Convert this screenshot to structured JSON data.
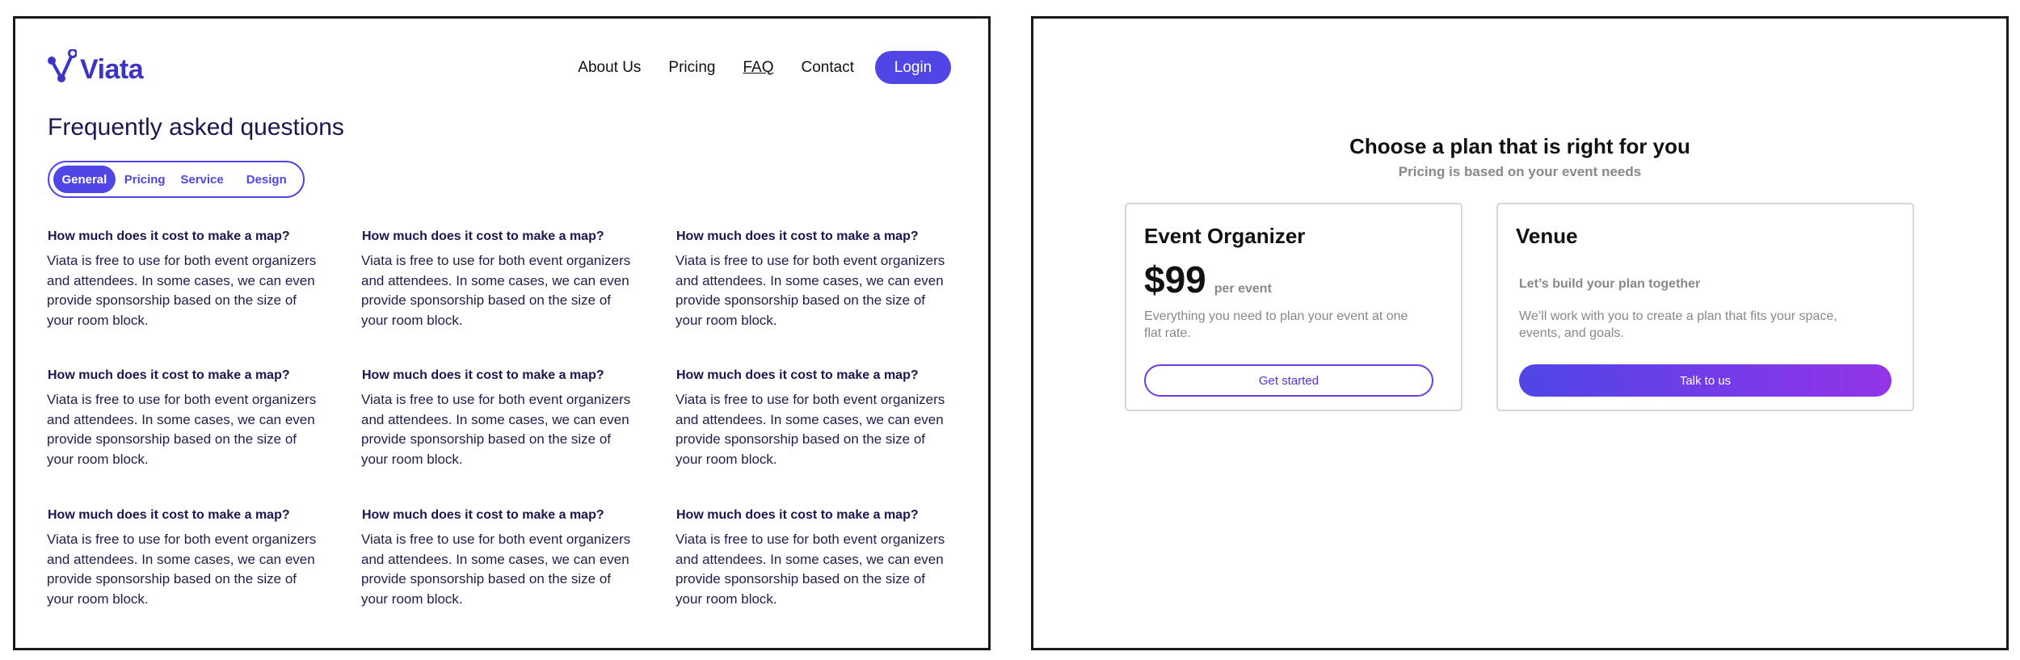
{
  "brand": {
    "name": "Viata",
    "accent": "#4f46e5",
    "logo_icon": "route-pin-icon"
  },
  "nav": {
    "items": [
      {
        "label": "About Us",
        "active": false
      },
      {
        "label": "Pricing",
        "active": false
      },
      {
        "label": "FAQ",
        "active": true
      },
      {
        "label": "Contact",
        "active": false
      }
    ],
    "login_label": "Login"
  },
  "faq": {
    "title": "Frequently asked questions",
    "tabs": [
      {
        "label": "General",
        "active": true
      },
      {
        "label": "Pricing",
        "active": false
      },
      {
        "label": "Service",
        "active": false
      },
      {
        "label": "Design",
        "active": false
      }
    ],
    "items": [
      {
        "question": "How much does it cost to make a map?",
        "answer": "Viata is free to use for both event organizers and attendees. In some cases, we can even provide sponsorship based on the size of your room block."
      },
      {
        "question": "How much does it cost to make a map?",
        "answer": "Viata is free to use for both event organizers and attendees. In some cases, we can even provide sponsorship based on the size of your room block."
      },
      {
        "question": "How much does it cost to make a map?",
        "answer": "Viata is free to use for both event organizers and attendees. In some cases, we can even provide sponsorship based on the size of your room block."
      },
      {
        "question": "How much does it cost to make a map?",
        "answer": "Viata is free to use for both event organizers and attendees. In some cases, we can even provide sponsorship based on the size of your room block."
      },
      {
        "question": "How much does it cost to make a map?",
        "answer": "Viata is free to use for both event organizers and attendees. In some cases, we can even provide sponsorship based on the size of your room block."
      },
      {
        "question": "How much does it cost to make a map?",
        "answer": "Viata is free to use for both event organizers and attendees. In some cases, we can even provide sponsorship based on the size of your room block."
      },
      {
        "question": "How much does it cost to make a map?",
        "answer": "Viata is free to use for both event organizers and attendees. In some cases, we can even provide sponsorship based on the size of your room block."
      },
      {
        "question": "How much does it cost to make a map?",
        "answer": "Viata is free to use for both event organizers and attendees. In some cases, we can even provide sponsorship based on the size of your room block."
      },
      {
        "question": "How much does it cost to make a map?",
        "answer": "Viata is free to use for both event organizers and attendees. In some cases, we can even provide sponsorship based on the size of your room block."
      }
    ]
  },
  "pricing": {
    "heading": "Choose a plan that is right for you",
    "subheading": "Pricing is based on your event needs",
    "plans": [
      {
        "name": "Event Organizer",
        "price": "$99",
        "price_unit": "per event",
        "description": "Everything you need to plan your event at one flat rate.",
        "cta": "Get started"
      },
      {
        "name": "Venue",
        "tagline": "Let’s build your plan together",
        "description": "We’ll work with you to create a plan that fits your space, events, and goals.",
        "cta": "Talk to us"
      }
    ]
  }
}
